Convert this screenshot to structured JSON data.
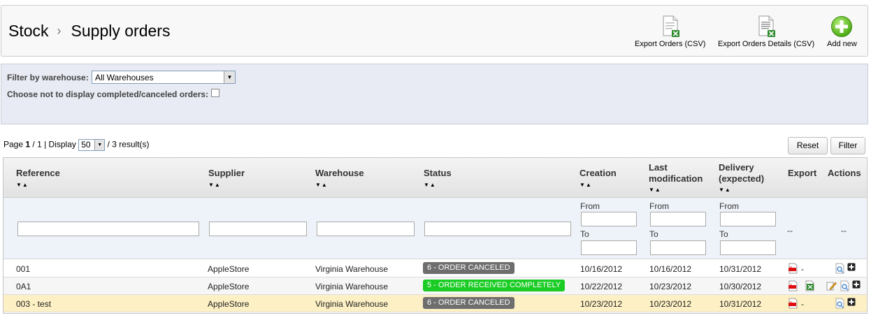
{
  "header": {
    "breadcrumb": [
      "Stock",
      "Supply orders"
    ],
    "breadcrumb_separator": "›",
    "toolbar": {
      "export_orders": "Export Orders (CSV)",
      "export_details": "Export Orders Details (CSV)",
      "add_new": "Add new"
    }
  },
  "filters": {
    "warehouse_label": "Filter by warehouse:",
    "warehouse_selected": "All Warehouses",
    "hide_completed_label": "Choose not to display completed/canceled orders:"
  },
  "pagination": {
    "page_word": "Page",
    "current_page": "1",
    "total_pages": " / 1 | Display ",
    "display_count": "50",
    "results": " / 3 result(s)"
  },
  "buttons": {
    "reset": "Reset",
    "filter": "Filter"
  },
  "table": {
    "columns": {
      "reference": "Reference",
      "supplier": "Supplier",
      "warehouse": "Warehouse",
      "status": "Status",
      "creation": "Creation",
      "last_mod_1": "Last",
      "last_mod_2": "modification",
      "delivery_1": "Delivery",
      "delivery_2": "(expected)",
      "export": "Export",
      "actions": "Actions"
    },
    "filter_labels": {
      "from": "From",
      "to": "To",
      "dash": "--"
    },
    "rows": [
      {
        "reference": "001",
        "supplier": "AppleStore",
        "warehouse": "Virginia Warehouse",
        "status": "6 - ORDER CANCELED",
        "creation": "10/16/2012",
        "last_modification": "10/16/2012",
        "delivery": "10/31/2012",
        "export_dash": "-"
      },
      {
        "reference": "0A1",
        "supplier": "AppleStore",
        "warehouse": "Virginia Warehouse",
        "status": "5 - ORDER RECEIVED COMPLETELY",
        "creation": "10/22/2012",
        "last_modification": "10/23/2012",
        "delivery": "10/30/2012",
        "export_dash": ""
      },
      {
        "reference": "003 - test",
        "supplier": "AppleStore",
        "warehouse": "Virginia Warehouse",
        "status": "6 - ORDER CANCELED",
        "creation": "10/23/2012",
        "last_modification": "10/23/2012",
        "delivery": "10/31/2012",
        "export_dash": "-"
      }
    ]
  },
  "colors": {
    "status_canceled": "#6e6e6e",
    "status_received": "#1bcc25",
    "highlight_row": "#fdf0c4",
    "filter_panel": "#e8ebf3"
  },
  "icons": {
    "export_orders": "csv-file-icon",
    "export_details": "csv-details-file-icon",
    "add_new": "plus-circle-icon",
    "sort": "sort-arrows-icon",
    "pdf": "pdf-icon",
    "excel": "excel-icon",
    "view": "view-details-icon",
    "edit": "edit-icon",
    "add": "plus-square-icon"
  }
}
